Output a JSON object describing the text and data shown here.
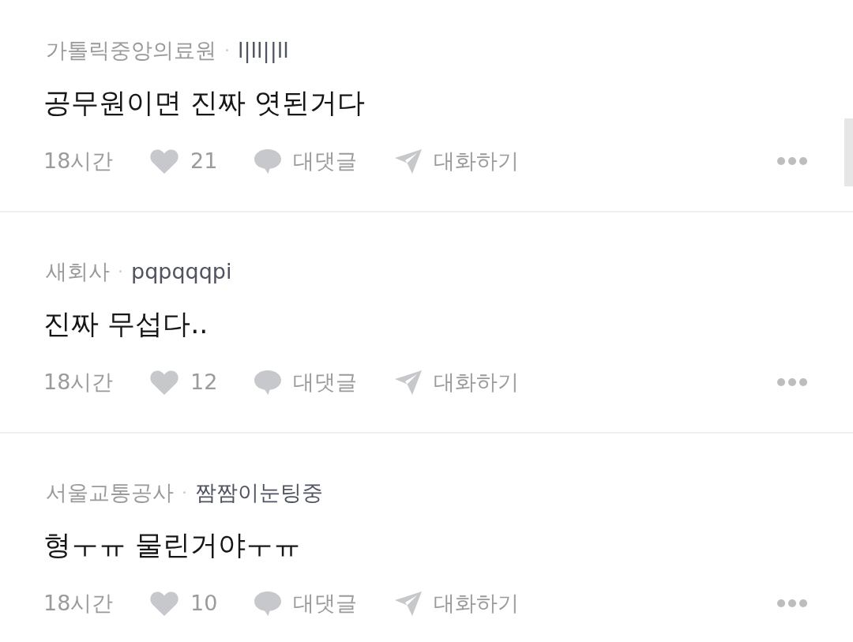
{
  "comments": [
    {
      "company": "가톨릭중앙의료원",
      "separator": "·",
      "author": "l|ll||ll",
      "text": "공무원이면 진짜 엿된거다",
      "time": "18시간",
      "likes": "21",
      "reply_label": "대댓글",
      "chat_label": "대화하기"
    },
    {
      "company": "새회사",
      "separator": "·",
      "author": "pqpqqqpi",
      "text": "진짜 무섭다..",
      "time": "18시간",
      "likes": "12",
      "reply_label": "대댓글",
      "chat_label": "대화하기"
    },
    {
      "company": "서울교통공사",
      "separator": "·",
      "author": "짬짬이눈팅중",
      "text": "형ㅜㅠ 물린거야ㅜㅠ",
      "time": "18시간",
      "likes": "10",
      "reply_label": "대댓글",
      "chat_label": "대화하기"
    }
  ]
}
